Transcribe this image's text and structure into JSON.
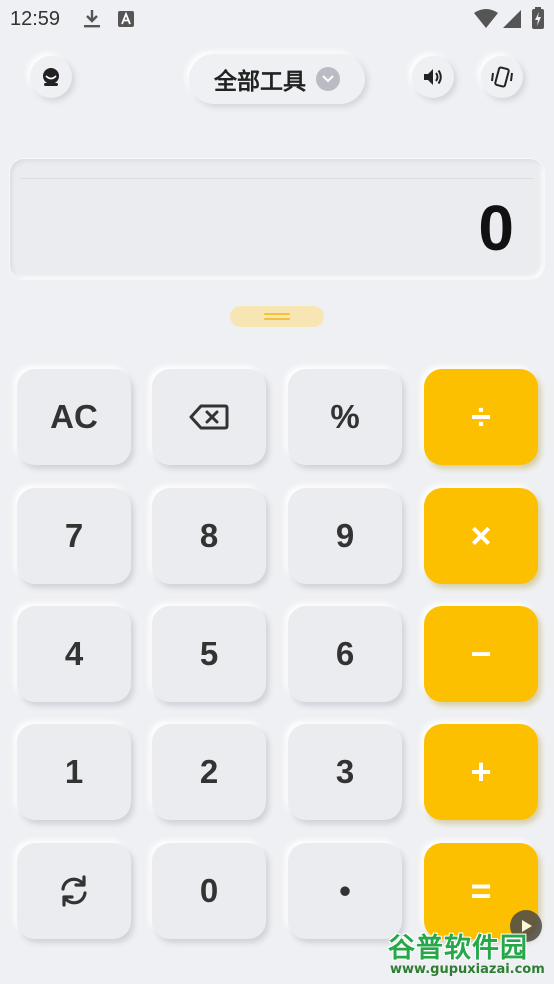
{
  "status_bar": {
    "time": "12:59",
    "icons": [
      "download-icon",
      "font-icon",
      "wifi-icon",
      "signal-icon",
      "battery-charging-icon"
    ]
  },
  "top_bar": {
    "left_icon": "theme-face-icon",
    "tool_selector": {
      "label": "全部工具",
      "icon": "chevron-down-icon"
    },
    "right_icons": [
      "sound-icon",
      "vibrate-icon"
    ]
  },
  "display": {
    "value": "0"
  },
  "keypad": {
    "rows": [
      [
        {
          "label": "AC",
          "type": "func"
        },
        {
          "label": "",
          "icon": "backspace-icon",
          "type": "func"
        },
        {
          "label": "%",
          "type": "func"
        },
        {
          "label": "÷",
          "type": "op"
        }
      ],
      [
        {
          "label": "7",
          "type": "num"
        },
        {
          "label": "8",
          "type": "num"
        },
        {
          "label": "9",
          "type": "num"
        },
        {
          "label": "×",
          "type": "op"
        }
      ],
      [
        {
          "label": "4",
          "type": "num"
        },
        {
          "label": "5",
          "type": "num"
        },
        {
          "label": "6",
          "type": "num"
        },
        {
          "label": "−",
          "type": "op"
        }
      ],
      [
        {
          "label": "1",
          "type": "num"
        },
        {
          "label": "2",
          "type": "num"
        },
        {
          "label": "3",
          "type": "num"
        },
        {
          "label": "+",
          "type": "op"
        }
      ],
      [
        {
          "label": "",
          "icon": "refresh-icon",
          "type": "func"
        },
        {
          "label": "0",
          "type": "num"
        },
        {
          "label": "•",
          "type": "num"
        },
        {
          "label": "=",
          "type": "op"
        }
      ]
    ]
  },
  "colors": {
    "accent": "#fcc000",
    "background": "#eff0f3",
    "key": "#ebecef"
  },
  "watermark": {
    "title": "谷普软件园",
    "url": "www.gupuxiazai.com"
  }
}
